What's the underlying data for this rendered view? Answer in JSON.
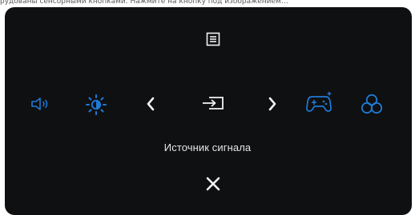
{
  "page": {
    "top_text": "рудованы сенсорными кнопками. Нажмите на кнопку под изображением…"
  },
  "osd": {
    "selected_label": "Источник сигнала",
    "icons": [
      {
        "name": "menu-icon"
      },
      {
        "name": "volume-icon"
      },
      {
        "name": "brightness-icon"
      },
      {
        "name": "chevron-left-icon"
      },
      {
        "name": "input-source-icon"
      },
      {
        "name": "chevron-right-icon"
      },
      {
        "name": "gamepad-icon"
      },
      {
        "name": "color-circles-icon"
      },
      {
        "name": "close-icon"
      }
    ]
  },
  "colors": {
    "background": "#0f1012",
    "icon_white": "#f2f2f2",
    "accent_blue": "#1f7ad6"
  }
}
